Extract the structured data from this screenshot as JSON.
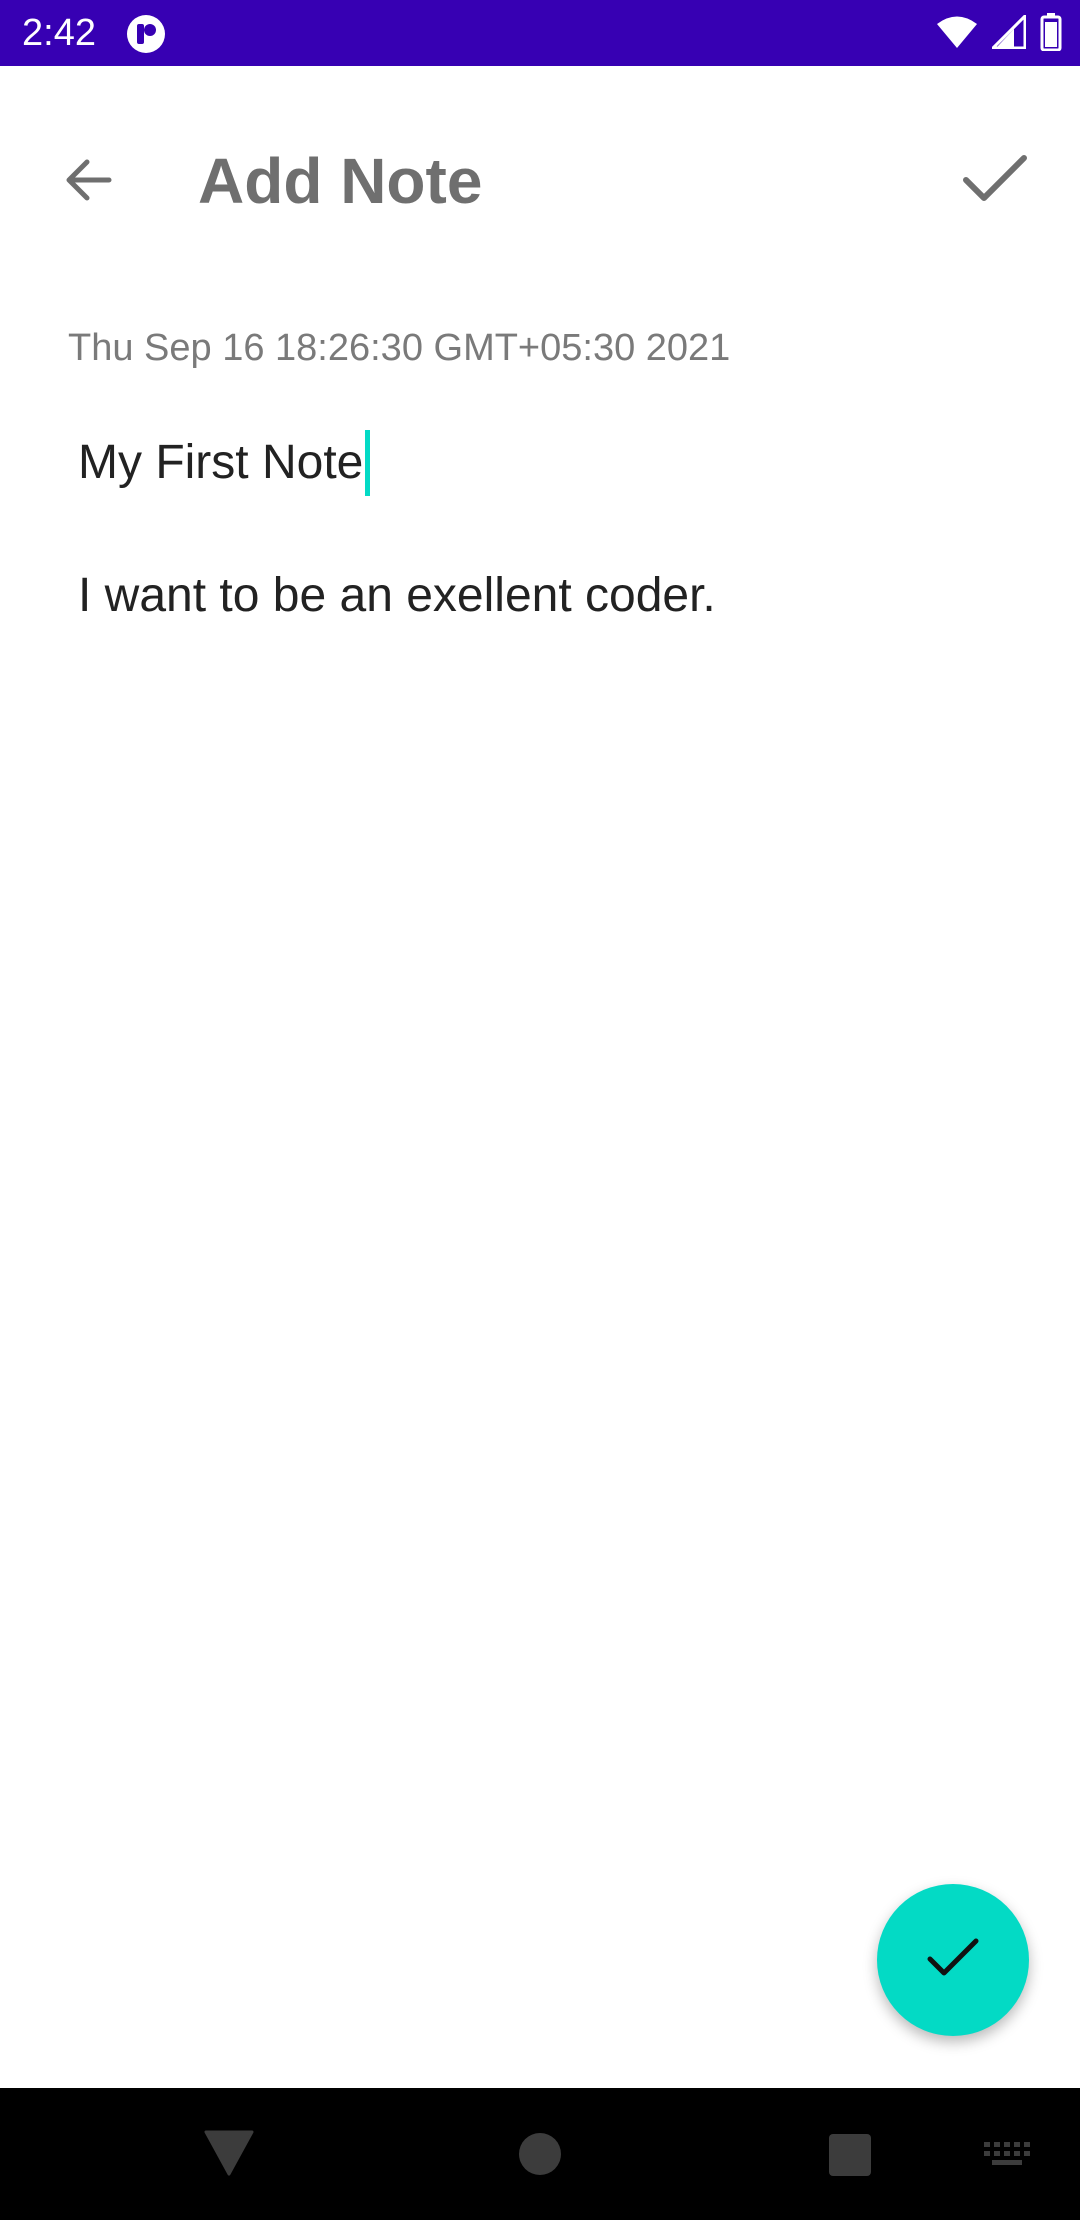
{
  "status_bar": {
    "time": "2:42",
    "background_color": "#3700b3",
    "app_notification_icon": "app-logo-icon",
    "icons": [
      "wifi-icon",
      "signal-icon",
      "battery-icon"
    ]
  },
  "app_bar": {
    "title": "Add Note",
    "back_icon": "arrow-back-icon",
    "action_icon": "check-icon"
  },
  "note": {
    "date": "Thu Sep 16 18:26:30 GMT+05:30 2021",
    "title_value": "My First Note",
    "body_value": "I want to be an exellent coder."
  },
  "fab": {
    "icon": "check-icon",
    "color": "#03dac5"
  },
  "colors": {
    "accent": "#03dac5",
    "primary_dark": "#3700b3",
    "title_text": "#6f6f6f"
  },
  "nav_bar": {
    "icons": [
      "nav-back-icon",
      "nav-home-icon",
      "nav-recents-icon",
      "keyboard-icon"
    ]
  }
}
